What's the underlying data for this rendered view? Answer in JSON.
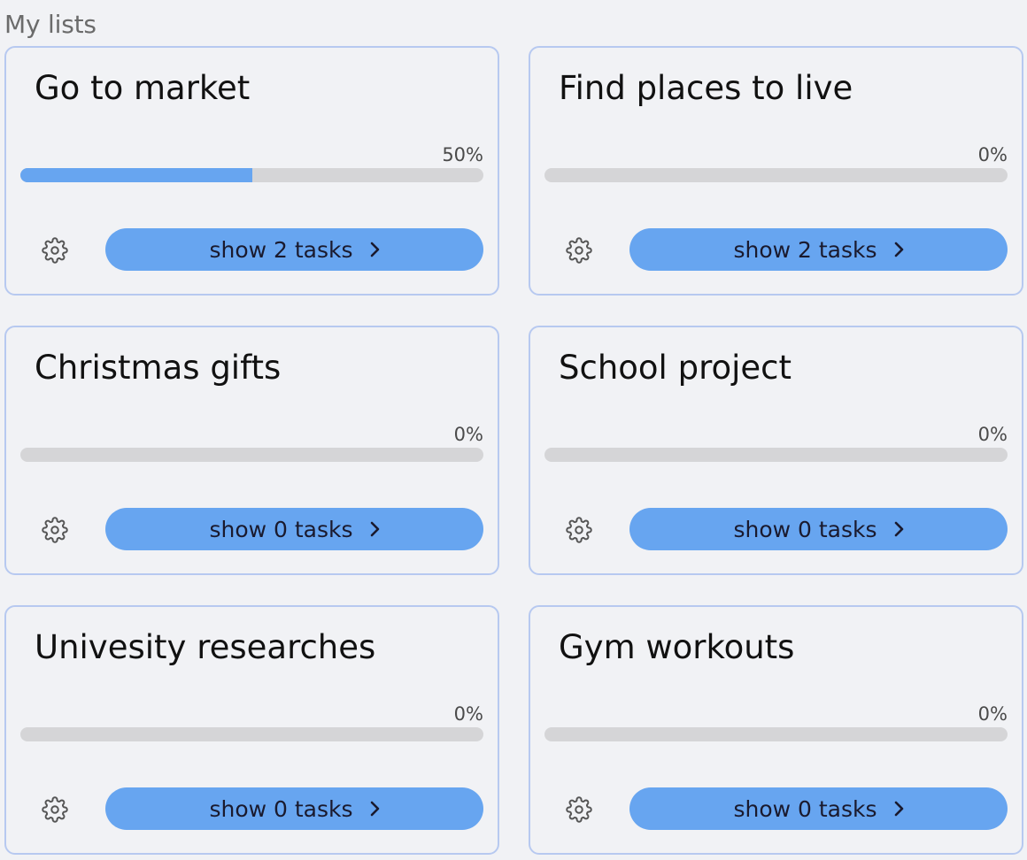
{
  "header": {
    "title": "My lists"
  },
  "accent": "#67a5f0",
  "lists": [
    {
      "title": "Go to market",
      "progress_label": "50%",
      "progress": 50,
      "button_label": "show 2 tasks",
      "settings_icon": "gear-icon",
      "button_icon": "chevron-right-icon"
    },
    {
      "title": "Find places to live",
      "progress_label": "0%",
      "progress": 0,
      "button_label": "show 2 tasks",
      "settings_icon": "gear-icon",
      "button_icon": "chevron-right-icon"
    },
    {
      "title": "Christmas gifts",
      "progress_label": "0%",
      "progress": 0,
      "button_label": "show 0 tasks",
      "settings_icon": "gear-icon",
      "button_icon": "chevron-right-icon"
    },
    {
      "title": "School project",
      "progress_label": "0%",
      "progress": 0,
      "button_label": "show 0 tasks",
      "settings_icon": "gear-icon",
      "button_icon": "chevron-right-icon"
    },
    {
      "title": "Univesity researches",
      "progress_label": "0%",
      "progress": 0,
      "button_label": "show 0 tasks",
      "settings_icon": "gear-icon",
      "button_icon": "chevron-right-icon"
    },
    {
      "title": "Gym workouts",
      "progress_label": "0%",
      "progress": 0,
      "button_label": "show 0 tasks",
      "settings_icon": "gear-icon",
      "button_icon": "chevron-right-icon"
    }
  ]
}
